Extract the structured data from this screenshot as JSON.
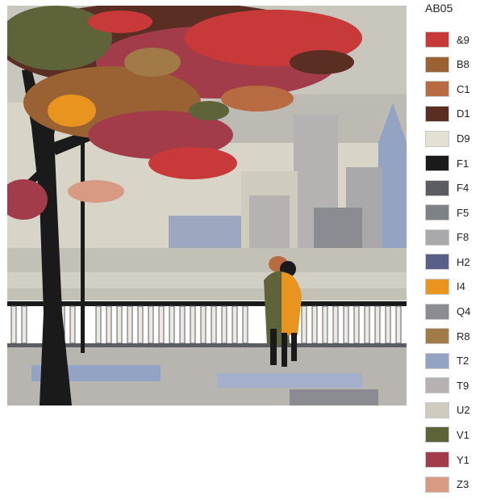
{
  "kit_code": "AB05",
  "painting": {
    "subject": "paint-by-numbers-preview-couple-under-autumn-tree-by-river"
  },
  "palette": [
    {
      "code": "&9",
      "color": "#c83a3a"
    },
    {
      "code": "B8",
      "color": "#9a6232"
    },
    {
      "code": "C1",
      "color": "#b86a40"
    },
    {
      "code": "D1",
      "color": "#5b2e24"
    },
    {
      "code": "D9",
      "color": "#e5e0d4"
    },
    {
      "code": "F1",
      "color": "#1a1a1a"
    },
    {
      "code": "F4",
      "color": "#5b5d62"
    },
    {
      "code": "F5",
      "color": "#7e8186"
    },
    {
      "code": "F8",
      "color": "#a9a9ab"
    },
    {
      "code": "H2",
      "color": "#5a5f88"
    },
    {
      "code": "I4",
      "color": "#e8941f"
    },
    {
      "code": "Q4",
      "color": "#8a8c92"
    },
    {
      "code": "R8",
      "color": "#a27a47"
    },
    {
      "code": "T2",
      "color": "#93a3c4"
    },
    {
      "code": "T9",
      "color": "#b6b2b2"
    },
    {
      "code": "U2",
      "color": "#cfcbbf"
    },
    {
      "code": "V1",
      "color": "#5e6339"
    },
    {
      "code": "Y1",
      "color": "#a23c4b"
    },
    {
      "code": "Z3",
      "color": "#d99a84"
    }
  ]
}
